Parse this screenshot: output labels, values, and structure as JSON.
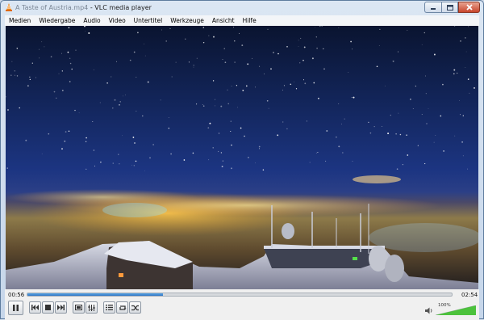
{
  "window": {
    "file_name": "A Taste of Austria.mp4",
    "app_title": "VLC media player",
    "separator": " - "
  },
  "menu": [
    "Medien",
    "Wiedergabe",
    "Audio",
    "Video",
    "Untertitel",
    "Werkzeuge",
    "Ansicht",
    "Hilfe"
  ],
  "player": {
    "elapsed": "00:56",
    "duration": "02:54",
    "progress_fraction": 0.32,
    "volume_label": "100%",
    "volume_fraction": 1.0,
    "state": "playing"
  },
  "icons": {
    "app": "vlc-cone-icon",
    "pause": "pause-icon",
    "previous": "previous-icon",
    "stop": "stop-icon",
    "next": "next-icon",
    "fullscreen": "fullscreen-icon",
    "extended": "extended-settings-icon",
    "playlist": "playlist-icon",
    "loop": "loop-icon",
    "random": "random-icon",
    "volume": "speaker-icon"
  },
  "colors": {
    "accent": "#2c74c4",
    "volume_fill": "#4cc23c"
  }
}
